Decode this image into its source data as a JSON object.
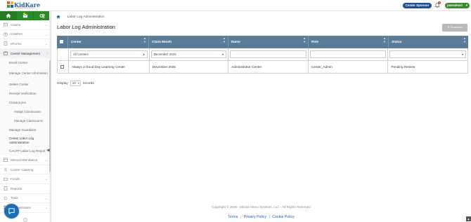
{
  "header": {
    "brand": "KidKare",
    "brand_sub": "by Minute Menu Systems",
    "sponsor_button": "Center Sponsor",
    "notifications_count": "1",
    "user_button": "jmendezcl"
  },
  "sidebar": {
    "items": [
      {
        "label": "Claims",
        "icon": "dollar-icon"
      },
      {
        "label": "Children",
        "icon": "child-icon"
      },
      {
        "label": "eForms",
        "icon": "form-icon"
      },
      {
        "label": "Center Management",
        "icon": "building-icon"
      }
    ],
    "sub_items": [
      "Enroll Center",
      "Manage Center Information",
      "Delete Center",
      "Receipt Verification",
      "Classrooms",
      "Assign Classrooms",
      "Manage Classrooms",
      "Manage Guardians",
      "Center Labor Log Administration",
      "CACFP Labor Log Report"
    ],
    "bottom_items": [
      {
        "label": "Menus/Attendance",
        "icon": "calendar-icon"
      },
      {
        "label": "Center Catering",
        "icon": "utensils-icon"
      },
      {
        "label": "Foods",
        "icon": "food-icon"
      },
      {
        "label": "Reports",
        "icon": "report-icon"
      },
      {
        "label": "Tools",
        "icon": "tools-icon"
      },
      {
        "label": "Administration",
        "icon": "admin-icon"
      }
    ]
  },
  "breadcrumb": {
    "current": "Labor Log Administration"
  },
  "page": {
    "title": "Labor Log Administration",
    "download_label": "Download"
  },
  "table": {
    "columns": [
      "Center",
      "Claim Month",
      "Name",
      "Role",
      "Status"
    ],
    "filters": {
      "center": "All Centers",
      "claim_month": "December 2025",
      "name": "",
      "role": "",
      "status": ""
    },
    "rows": [
      {
        "center": "Always a Good Day Learning Center",
        "claim_month": "December 2025",
        "name": "Administrator Center",
        "role": "Center_Admin",
        "status": "Pending Review"
      }
    ]
  },
  "pagination": {
    "display_label": "Display",
    "page_size": "10",
    "records_label": "records"
  },
  "footer": {
    "copyright": "Copyright © 2026 - Minute Menu Systems, LLC - All Rights Reserved",
    "links": [
      "Terms",
      "Privacy Policy",
      "Cookie Policy"
    ]
  },
  "colors": {
    "nav_green": "#2d8a2a",
    "sponsor_blue": "#1f4f91",
    "table_header": "#5b7d99",
    "link_blue": "#1d5fa8"
  }
}
